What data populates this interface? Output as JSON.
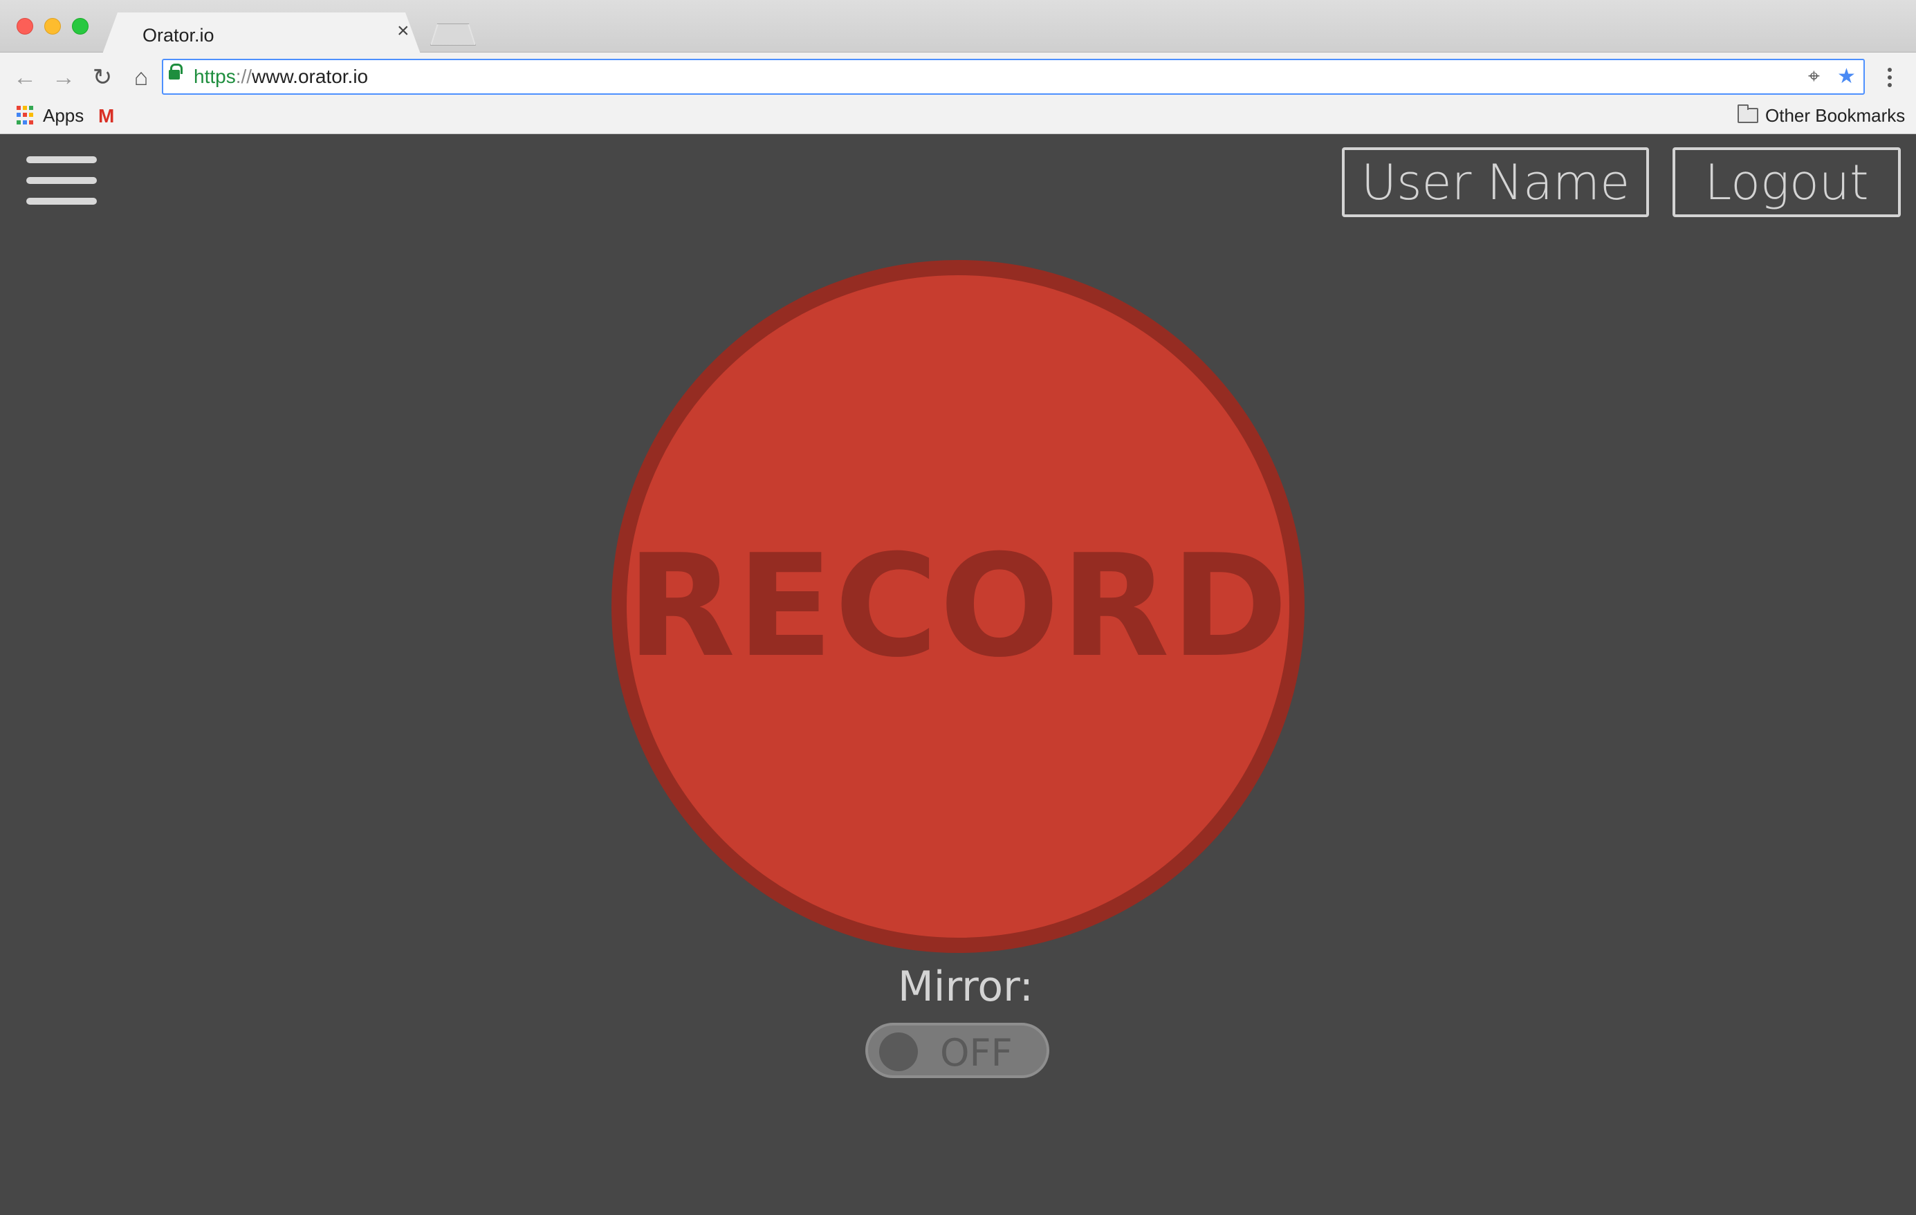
{
  "browser": {
    "tab_title": "Orator.io",
    "tab_close": "×",
    "url_scheme": "https",
    "url_sep": "://",
    "url_host": "www.orator.io",
    "bookmarks": {
      "apps_label": "Apps",
      "gmail_glyph": "M",
      "other_label": "Other Bookmarks"
    },
    "nav": {
      "back_glyph": "←",
      "forward_glyph": "→",
      "reload_glyph": "↻",
      "home_glyph": "⌂",
      "location_glyph": "⌖",
      "star_glyph": "★"
    },
    "colors": {
      "secure": "#1e8e3e",
      "star": "#4a8af4",
      "apps_grid": [
        "#ea4335",
        "#fbbc05",
        "#34a853",
        "#4285f4",
        "#ea4335",
        "#fbbc05",
        "#34a853",
        "#4285f4",
        "#ea4335"
      ]
    }
  },
  "app": {
    "header": {
      "user_label": "User Name",
      "logout_label": "Logout"
    },
    "record_label": "RECORD",
    "mirror": {
      "label": "Mirror:",
      "state": "OFF"
    },
    "colors": {
      "background": "#474747",
      "record_fill": "#c73d2f",
      "record_ring": "#952c22",
      "text_light": "#d4d4d4"
    }
  }
}
